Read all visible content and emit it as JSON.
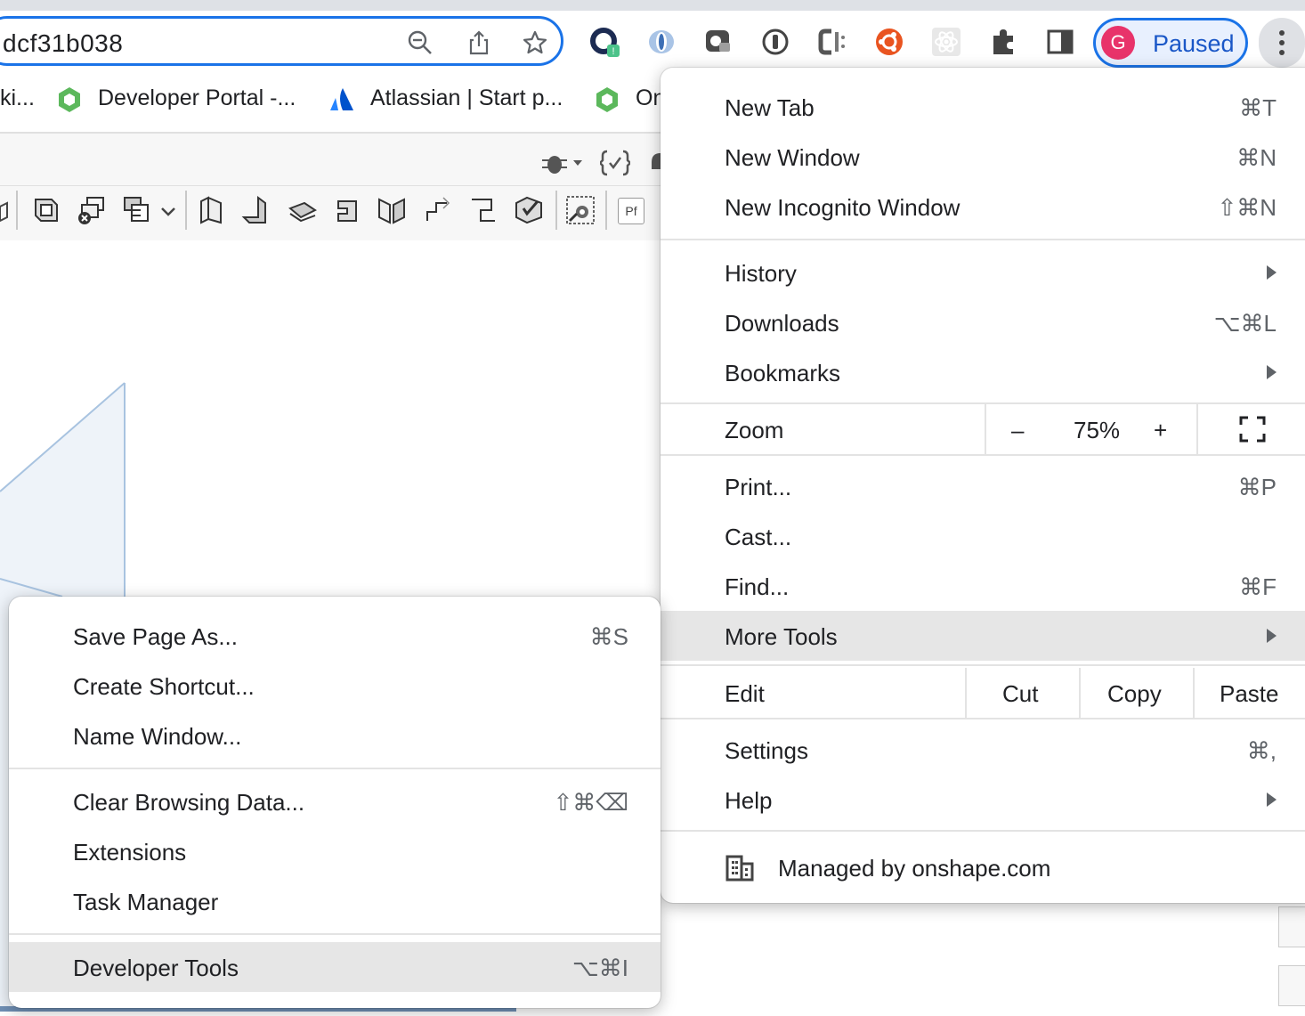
{
  "omnibox": {
    "url": "dcf31b038"
  },
  "profile": {
    "initial": "G",
    "status": "Paused"
  },
  "bookmarks": [
    {
      "label": "ki..."
    },
    {
      "label": "Developer Portal -..."
    },
    {
      "label": "Atlassian | Start p..."
    },
    {
      "label": "On"
    }
  ],
  "toolbar": {
    "pf_label": "Pf"
  },
  "chrome_menu": {
    "new_tab": {
      "label": "New Tab",
      "shortcut": "⌘T"
    },
    "new_window": {
      "label": "New Window",
      "shortcut": "⌘N"
    },
    "new_incognito": {
      "label": "New Incognito Window",
      "shortcut": "⇧⌘N"
    },
    "history": {
      "label": "History"
    },
    "downloads": {
      "label": "Downloads",
      "shortcut": "⌥⌘L"
    },
    "bookmarks": {
      "label": "Bookmarks"
    },
    "zoom": {
      "label": "Zoom",
      "minus": "–",
      "value": "75%",
      "plus": "+"
    },
    "print": {
      "label": "Print...",
      "shortcut": "⌘P"
    },
    "cast": {
      "label": "Cast..."
    },
    "find": {
      "label": "Find...",
      "shortcut": "⌘F"
    },
    "more_tools": {
      "label": "More Tools"
    },
    "edit": {
      "label": "Edit",
      "cut": "Cut",
      "copy": "Copy",
      "paste": "Paste"
    },
    "settings": {
      "label": "Settings",
      "shortcut": "⌘,"
    },
    "help": {
      "label": "Help"
    },
    "managed": {
      "label": "Managed by onshape.com"
    }
  },
  "more_tools_menu": {
    "save_page": {
      "label": "Save Page As...",
      "shortcut": "⌘S"
    },
    "create_shortcut": {
      "label": "Create Shortcut..."
    },
    "name_window": {
      "label": "Name Window..."
    },
    "clear_browsing": {
      "label": "Clear Browsing Data...",
      "shortcut": "⇧⌘⌫"
    },
    "extensions": {
      "label": "Extensions"
    },
    "task_manager": {
      "label": "Task Manager"
    },
    "developer_tools": {
      "label": "Developer Tools",
      "shortcut": "⌥⌘I"
    }
  },
  "colors": {
    "accent": "#1a73e8",
    "avatar": "#e8336a",
    "highlight": "#e6e6e6",
    "ubuntu_ext": "#e95420"
  }
}
